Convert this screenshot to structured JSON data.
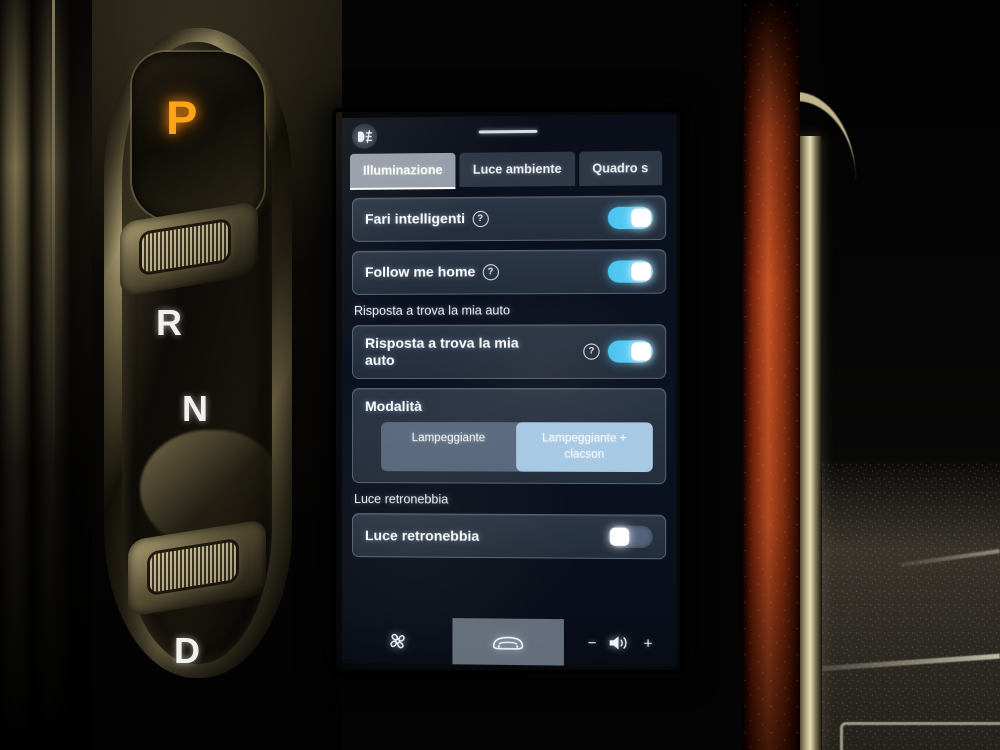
{
  "screen": {
    "status_icon": "fog-light-icon",
    "drag_handle": "drag-handle",
    "tabs": [
      {
        "label": "Illuminazione",
        "active": true
      },
      {
        "label": "Luce ambiente",
        "active": false
      },
      {
        "label": "Quadro s",
        "active": false,
        "clipped": true
      }
    ],
    "settings": [
      {
        "id": "fari-intelligenti",
        "label": "Fari intelligenti",
        "help": "?",
        "toggle": "on"
      },
      {
        "id": "follow-me-home",
        "label": "Follow me home",
        "help": "?",
        "toggle": "on"
      }
    ],
    "section_find_my_car": {
      "title": "Risposta a trova la mia auto",
      "row": {
        "label": "Risposta a trova la mia auto",
        "help": "?",
        "toggle": "on"
      },
      "mode": {
        "label": "Modalità",
        "options": [
          {
            "label": "Lampeggiante",
            "selected": false
          },
          {
            "label": "Lampeggiante + clacson",
            "selected": true
          }
        ]
      }
    },
    "section_rear_fog": {
      "title": "Luce retronebbia",
      "row": {
        "label": "Luce retronebbia",
        "toggle": "off"
      }
    },
    "bottom_nav": {
      "climate_icon": "fan-icon",
      "car_icon": "car-front-icon",
      "volume_minus": "−",
      "volume_icon": "speaker-icon",
      "volume_plus": "+"
    },
    "colors": {
      "accent_toggle_on": "#49c4f0",
      "card_background": "#2f3a4a",
      "screen_background": "#0b1220",
      "tab_active": "#c4ced a",
      "segment_selected": "#b2d6f2"
    }
  },
  "vehicle": {
    "gear_selector": {
      "park_indicator": "P",
      "park_color": "#ffa517",
      "positions": [
        "R",
        "N",
        "D"
      ]
    }
  }
}
